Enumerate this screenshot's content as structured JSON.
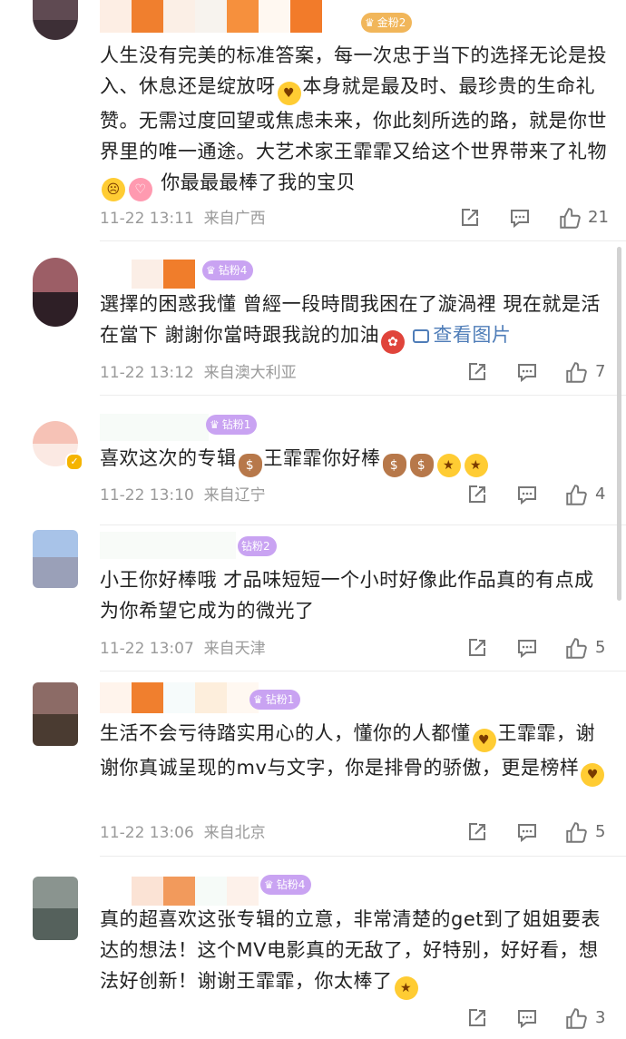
{
  "comments": [
    {
      "badge": "金粉2",
      "text_parts": [
        "人生没有完美的标准答案，每一次忠于当下的选择无论是投入、休息还是绽放呀",
        "本身就是最及时、最珍贵的生命礼赞。无需过度回望或焦虑未来，你此刻所选的路，就是你世界里的唯一通途。大艺术家王霏霏又给这个世界带来了礼物",
        "你最最最棒了我的宝贝"
      ],
      "time": "11-22 13:11",
      "location": "来自广西",
      "likes": "21"
    },
    {
      "badge": "钻粉4",
      "text_parts": [
        "選擇的困惑我懂 曾經一段時間我困在了漩渦裡 現在就是活在當下 謝謝你當時跟我說的加油"
      ],
      "link": "查看图片",
      "time": "11-22 13:12",
      "location": "来自澳大利亚",
      "likes": "7"
    },
    {
      "badge": "钻粉1",
      "text_parts": [
        "喜欢这次的专辑",
        "王霏霏你好棒"
      ],
      "time": "11-22 13:10",
      "location": "来自辽宁",
      "likes": "4"
    },
    {
      "badge": "钻粉2",
      "text_parts": [
        "小王你好棒哦 才品味短短一个小时好像此作品真的有点成为你希望它成为的微光了"
      ],
      "time": "11-22 13:07",
      "location": "来自天津",
      "likes": "5"
    },
    {
      "badge": "钻粉1",
      "text_parts": [
        "生活不会亏待踏实用心的人，懂你的人都懂",
        "王霏霏，谢谢你真诚呈现的mv与文字，你是排骨的骄傲，更是榜样"
      ],
      "time": "11-22 13:06",
      "location": "来自北京",
      "likes": "5"
    },
    {
      "badge": "钻粉4",
      "text_parts": [
        "真的超喜欢这张专辑的立意，非常清楚的get到了姐姐要表达的想法！这个MV电影真的无敌了，好特别，好好看，想法好创新！谢谢王霏霏，你太棒了"
      ],
      "time": "",
      "location": "",
      "likes": "3"
    }
  ],
  "icons": {
    "share": "share-icon",
    "comment": "comment-icon",
    "like": "thumbs-up-icon",
    "image": "image-icon"
  },
  "colors": {
    "text": "#222222",
    "meta": "#9a9a9a",
    "link": "#4f7db8",
    "badge_diamond": "#c9a3f2",
    "badge_gold": "#f1b65a"
  }
}
